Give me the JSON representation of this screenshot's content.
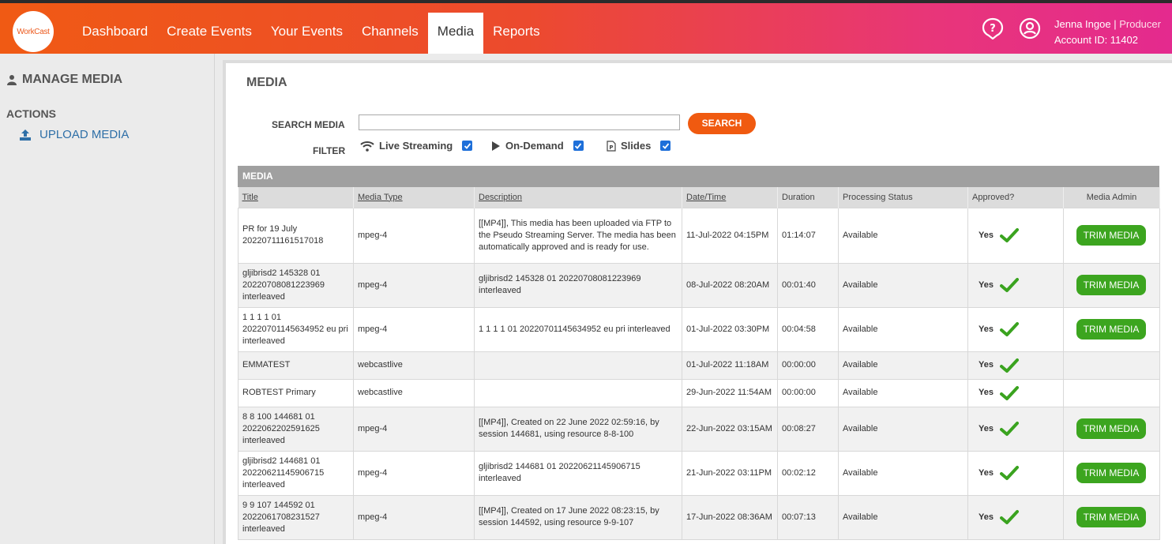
{
  "header": {
    "logo_text": "WorkCast",
    "nav": [
      {
        "label": "Dashboard"
      },
      {
        "label": "Create Events"
      },
      {
        "label": "Your Events"
      },
      {
        "label": "Channels"
      },
      {
        "label": "Media"
      },
      {
        "label": "Reports"
      }
    ],
    "active_nav": "Media",
    "user_name": "Jenna Ingoe",
    "separator": "|",
    "user_role": "Producer",
    "account_id": "Account ID: 11402",
    "accent_color": "#f05a14"
  },
  "sidebar": {
    "title": "MANAGE MEDIA",
    "actions_label": "ACTIONS",
    "upload_label": "UPLOAD MEDIA"
  },
  "main": {
    "title": "MEDIA",
    "search_label": "SEARCH MEDIA",
    "search_value": "",
    "search_button": "SEARCH",
    "filter_label": "FILTER",
    "filters": [
      {
        "label": "Live Streaming",
        "checked": true,
        "icon": "wifi-icon"
      },
      {
        "label": "On-Demand",
        "checked": true,
        "icon": "play-icon"
      },
      {
        "label": "Slides",
        "checked": true,
        "icon": "slides-icon"
      }
    ],
    "table_title": "MEDIA",
    "columns": [
      "Title",
      "Media Type",
      "Description",
      "Date/Time",
      "Duration",
      "Processing Status",
      "Approved?",
      "Media Admin"
    ],
    "trim_label": "TRIM MEDIA",
    "yes_label": "Yes",
    "rows": [
      {
        "title": "PR for 19 July 20220711161517018",
        "type": "mpeg-4",
        "description": "[[MP4]], This media has been uploaded via FTP to the Pseudo Streaming Server. The media has been automatically approved and is ready for use.",
        "date": "11-Jul-2022 04:15PM",
        "duration": "01:14:07",
        "status": "Available",
        "trim": true
      },
      {
        "title": "gljibrisd2 145328 01 20220708081223969 interleaved",
        "type": "mpeg-4",
        "description": "gljibrisd2 145328 01 20220708081223969 interleaved",
        "date": "08-Jul-2022 08:20AM",
        "duration": "00:01:40",
        "status": "Available",
        "trim": true
      },
      {
        "title": "1 1 1 1 01 20220701145634952 eu pri interleaved",
        "type": "mpeg-4",
        "description": "1 1 1 1 01 20220701145634952 eu pri interleaved",
        "date": "01-Jul-2022 03:30PM",
        "duration": "00:04:58",
        "status": "Available",
        "trim": true
      },
      {
        "title": "EMMATEST",
        "type": "webcastlive",
        "description": "",
        "date": "01-Jul-2022 11:18AM",
        "duration": "00:00:00",
        "status": "Available",
        "trim": false
      },
      {
        "title": "ROBTEST Primary",
        "type": "webcastlive",
        "description": "",
        "date": "29-Jun-2022 11:54AM",
        "duration": "00:00:00",
        "status": "Available",
        "trim": false
      },
      {
        "title": "8 8 100 144681 01 2022062202591625 interleaved",
        "type": "mpeg-4",
        "description": "[[MP4]], Created on 22 June 2022 02:59:16, by session 144681, using resource 8-8-100",
        "date": "22-Jun-2022 03:15AM",
        "duration": "00:08:27",
        "status": "Available",
        "trim": true
      },
      {
        "title": "gljibrisd2 144681 01 20220621145906715 interleaved",
        "type": "mpeg-4",
        "description": "gljibrisd2 144681 01 20220621145906715 interleaved",
        "date": "21-Jun-2022 03:11PM",
        "duration": "00:02:12",
        "status": "Available",
        "trim": true
      },
      {
        "title": "9 9 107 144592 01 2022061708231527 interleaved",
        "type": "mpeg-4",
        "description": "[[MP4]], Created on 17 June 2022 08:23:15, by session 144592, using resource 9-9-107",
        "date": "17-Jun-2022 08:36AM",
        "duration": "00:07:13",
        "status": "Available",
        "trim": true
      }
    ]
  }
}
